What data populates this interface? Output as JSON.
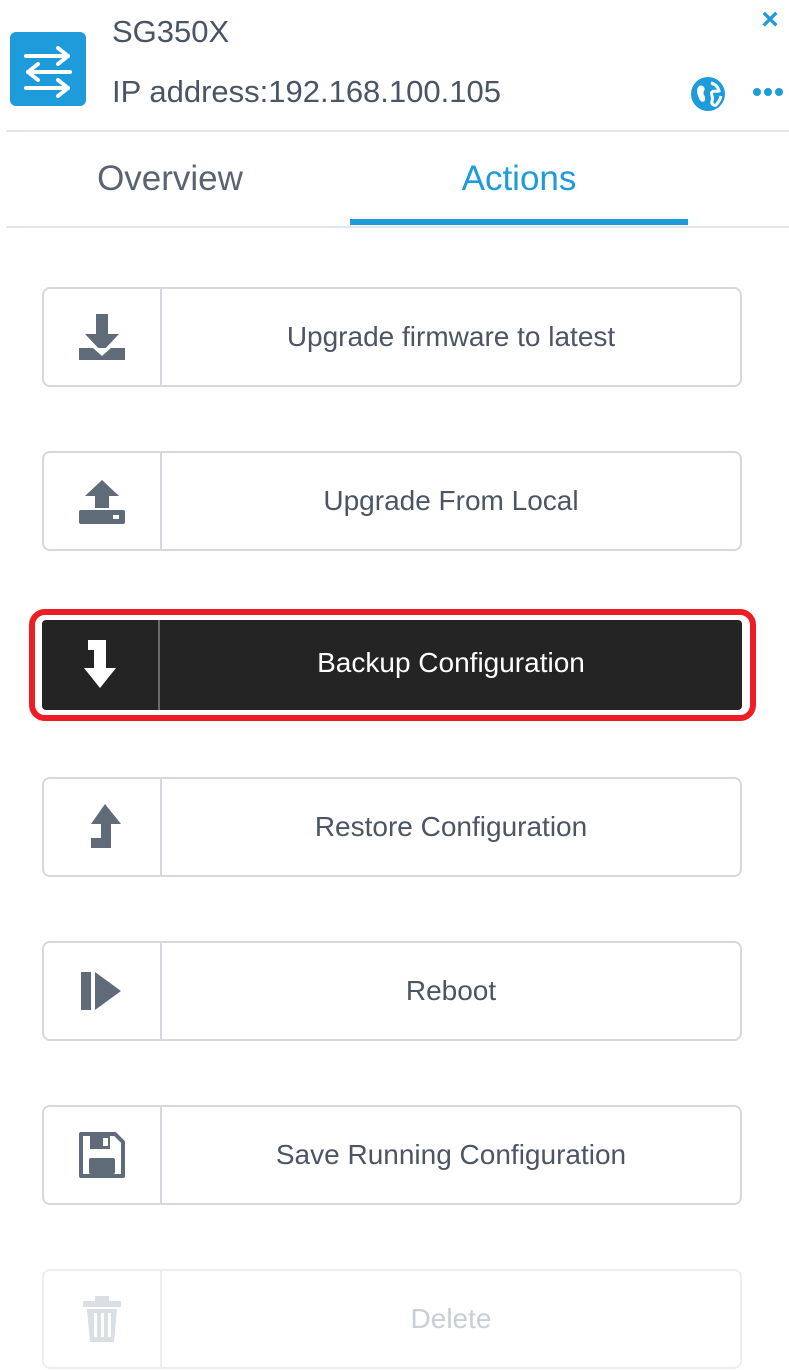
{
  "header": {
    "device_name": "SG350X",
    "ip_address": "IP address:192.168.100.105",
    "close_symbol": "×",
    "icons": [
      "switch-icon",
      "close-icon",
      "globe-icon",
      "more-icon"
    ]
  },
  "tabs": [
    {
      "label": "Overview",
      "active": false
    },
    {
      "label": "Actions",
      "active": true
    }
  ],
  "actions": [
    {
      "label": "Upgrade firmware to latest",
      "icon": "download-icon",
      "state": "normal"
    },
    {
      "label": "Upgrade From Local",
      "icon": "upload-icon",
      "state": "normal"
    },
    {
      "label": "Backup Configuration",
      "icon": "backup-arrow-icon",
      "state": "highlighted"
    },
    {
      "label": "Restore Configuration",
      "icon": "restore-arrow-icon",
      "state": "normal"
    },
    {
      "label": "Reboot",
      "icon": "reboot-icon",
      "state": "normal"
    },
    {
      "label": "Save Running Configuration",
      "icon": "save-icon",
      "state": "normal"
    },
    {
      "label": "Delete",
      "icon": "trash-icon",
      "state": "disabled"
    }
  ],
  "colors": {
    "accent": "#1d9bdb",
    "highlight_border": "#ee1c24",
    "highlight_bg": "#242424",
    "icon_gray": "#5f6b78"
  }
}
